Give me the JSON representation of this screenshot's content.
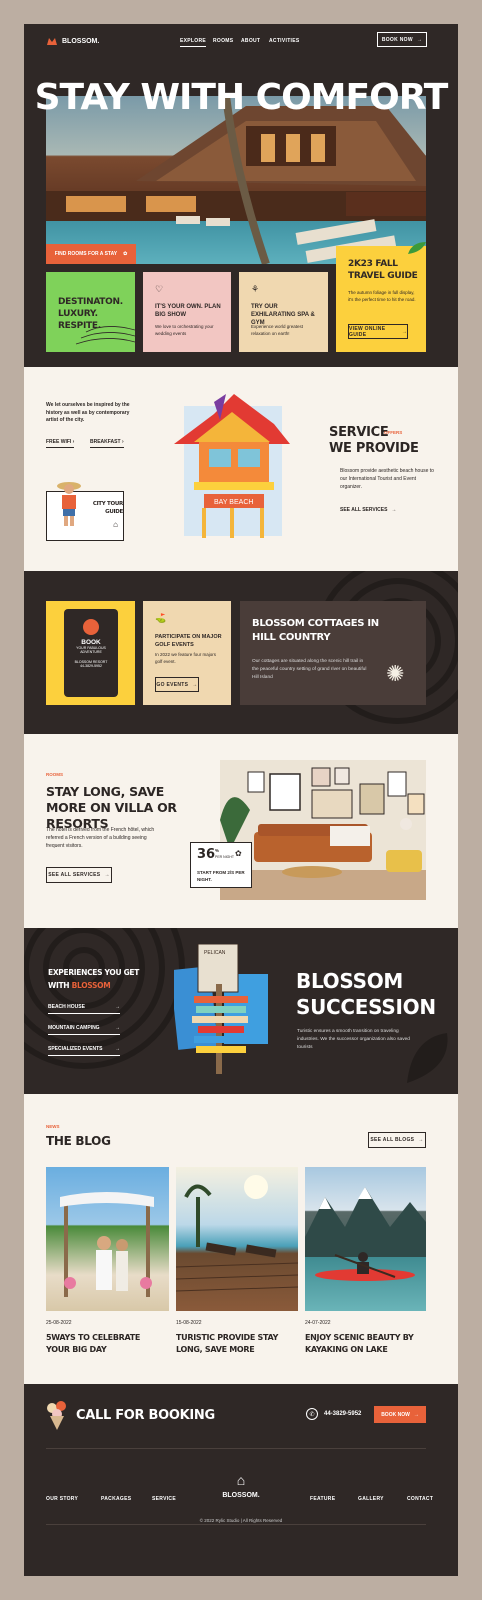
{
  "header": {
    "brand": "BLOSSOM.",
    "nav": [
      "EXPLORE",
      "ROOMS",
      "ABOUT",
      "ACTIVITIES"
    ],
    "book_now": "BOOK NOW"
  },
  "hero": {
    "title": "STAY WITH COMFORT",
    "find_rooms": "FIND ROOMS FOR A STAY"
  },
  "features": [
    {
      "title": "DESTINATON. LUXURY. RESPITE."
    },
    {
      "title": "IT'S YOUR OWN. PLAN BIG SHOW",
      "desc": "We love to orchestrating your wedding events"
    },
    {
      "title": "TRY OUR EXHILARATING SPA & GYM",
      "desc": "Experience world greatest relaxation on earth!"
    },
    {
      "title": "2K23 FALL TRAVEL GUIDE",
      "desc": "The autumn foliage in full display, it's the perfect time to hit the road.",
      "button": "VIEW ONLINE GUIDE"
    }
  ],
  "service": {
    "intro": "We let ourselves be inspired by the history as well as by contemporary artist of the city.",
    "link1": "FREE WIFI",
    "link2": "BREAKFAST",
    "city_tour": "CITY TOUR GUIDE",
    "title_line1": "SERVICE",
    "title_line2": "WE PROVIDE",
    "tag": "OFFERS",
    "desc": "Blossom provide aesthetic beach house to our International Tourist and Event organizer.",
    "see_all": "SEE ALL SERVICES",
    "tower_sign": "BAY BEACH"
  },
  "cottages": {
    "book_sign": {
      "title": "BOOK",
      "sub1": "YOUR FABULOUS",
      "sub2": "ADVENTURE",
      "resort": "BLOSSOM RESORT",
      "phone": "44-3829-5952"
    },
    "golf": {
      "title": "PARTICIPATE ON MAJOR GOLF EVENTS",
      "desc": "In 2022 we feature four majors golf event.",
      "button": "GO EVENTS"
    },
    "title": "BLOSSOM COTTAGES IN HILL COUNTRY",
    "desc": "Our cottages are situated along the scenic hill trail in the peaceful country setting of grand river on beautiful Hill Island"
  },
  "rooms": {
    "tag": "ROOMS",
    "title": "STAY LONG, SAVE MORE ON VILLA OR RESORTS",
    "desc": "The hotel is derived from the French hôtel, which referred a French version of a building seeing frequent visitors.",
    "button": "SEE ALL SERVICES",
    "badge_num": "36",
    "badge_unit1": "%",
    "badge_unit2": "PER NIGHT",
    "badge_text": "START FROM 2/S PER NIGHT."
  },
  "experiences": {
    "title_a": "EXPERIENCES YOU GET",
    "title_b": "WITH",
    "title_brand": "BLOSSOM",
    "items": [
      "BEACH HOUSE",
      "MOUNTAIN CAMPING",
      "SPECIALIZED EVENTS"
    ],
    "heading_line1": "BLOSSOM",
    "heading_line2": "SUCCESSION",
    "desc": "Turistic ensures a smooth transition on traveling industries. We the successor organization also saved tourists",
    "sign_top": "PELICAN WARNING"
  },
  "blog": {
    "tag": "NEWS",
    "title": "THE BLOG",
    "see_all": "SEE ALL BLOGS",
    "posts": [
      {
        "date": "25-08-2022",
        "title": "5WAYS TO CELEBRATE YOUR BIG DAY"
      },
      {
        "date": "15-08-2022",
        "title": "TURISTIC PROVIDE STAY LONG, SAVE MORE"
      },
      {
        "date": "24-07-2022",
        "title": "ENJOY SCENIC BEAUTY BY KAYAKING ON LAKE"
      }
    ]
  },
  "footer": {
    "call": "CALL FOR BOOKING",
    "phone": "44-3829-5952",
    "book_now": "BOOK NOW",
    "links_left": [
      "OUR STORY",
      "PACKAGES",
      "SERVICE"
    ],
    "brand": "BLOSSOM.",
    "links_right": [
      "FEATURE",
      "GALLERY",
      "CONTACT"
    ],
    "copyright": "© 2022 Rylic Studio | All Rights Reserved"
  },
  "colors": {
    "accent": "#e8623a",
    "dark": "#2f2826",
    "cream": "#f8f3ec",
    "green": "#7fd25a",
    "pink": "#f2c6c2",
    "sand": "#f0d8b0",
    "yellow": "#fcd03d"
  }
}
